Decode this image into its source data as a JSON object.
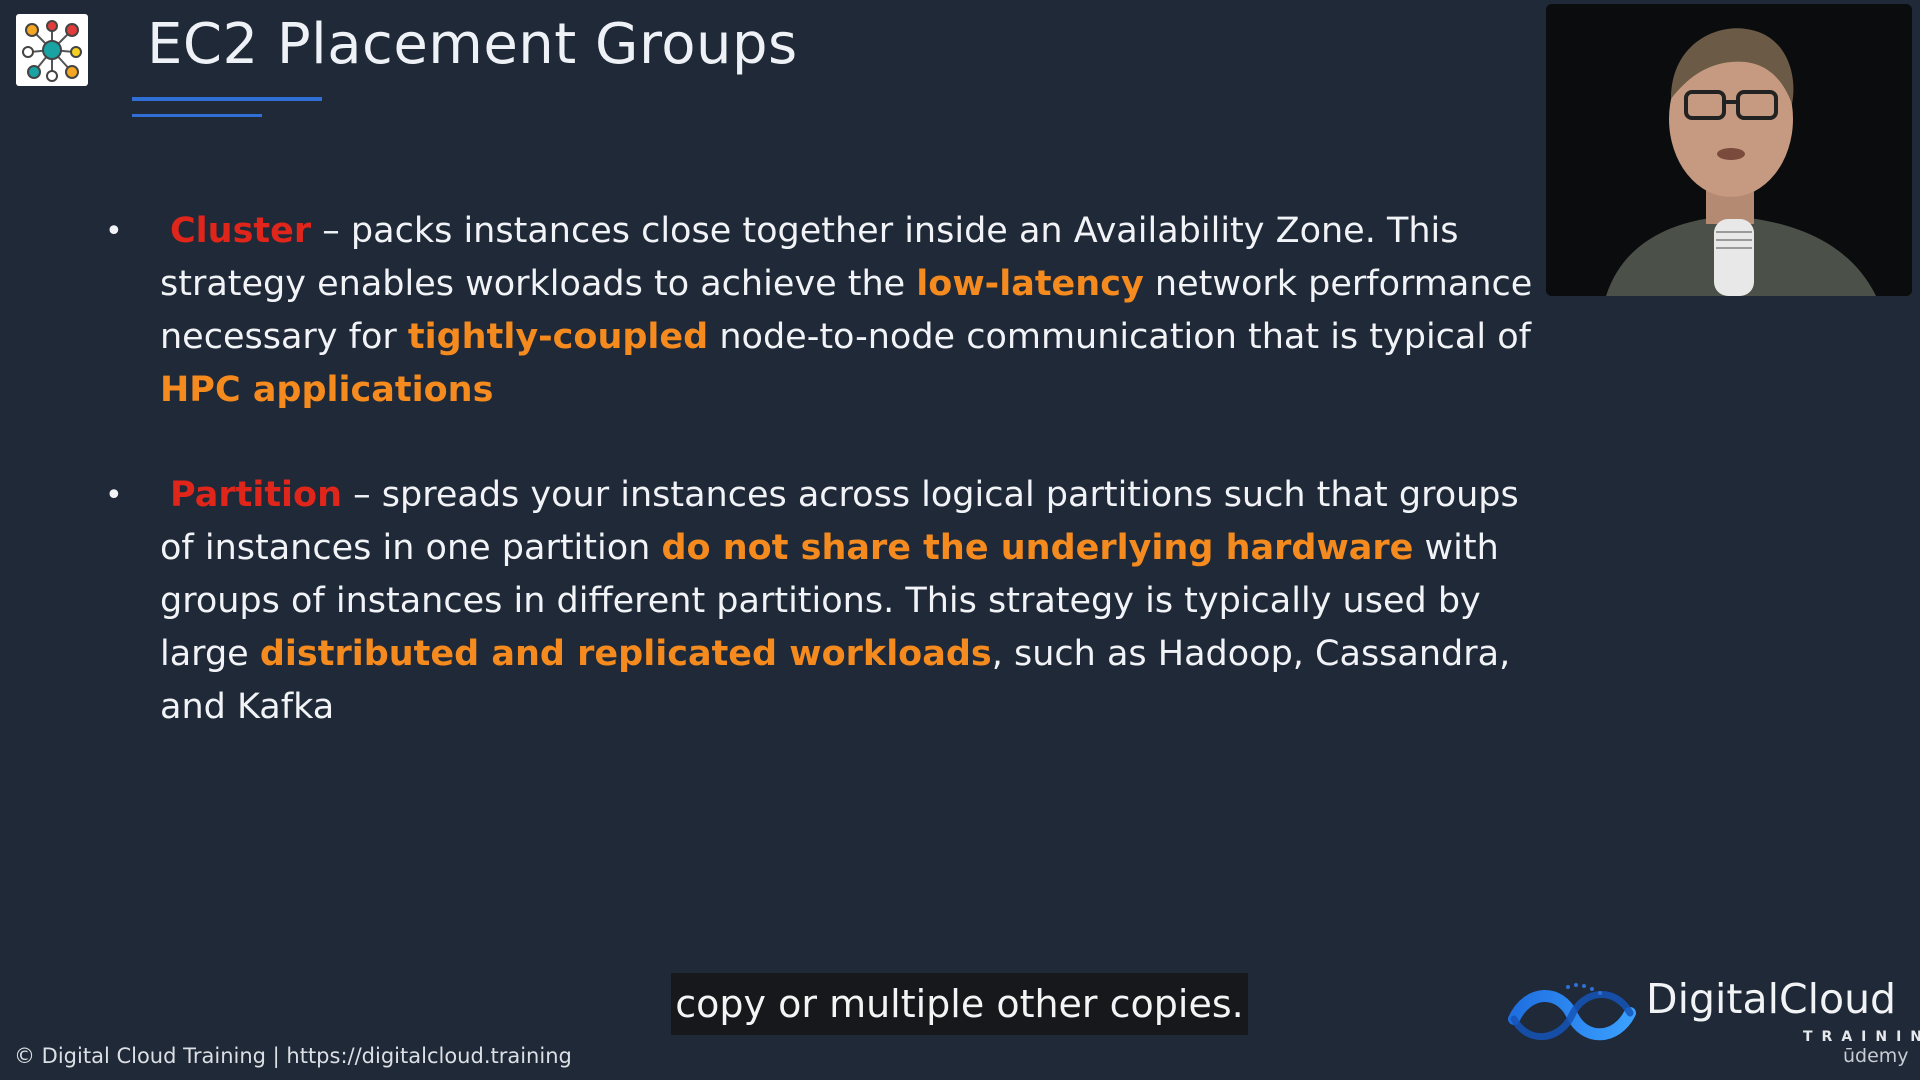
{
  "slide": {
    "title": "EC2 Placement Groups",
    "bullets": [
      {
        "term": "Cluster",
        "parts": [
          {
            "text": " – packs instances close together inside an Availability Zone. This strategy enables workloads to achieve the ",
            "highlight": false
          },
          {
            "text": "low-latency",
            "highlight": true
          },
          {
            "text": " network performance necessary for ",
            "highlight": false
          },
          {
            "text": "tightly-coupled",
            "highlight": true
          },
          {
            "text": " node-to-node communication that is typical of ",
            "highlight": false
          },
          {
            "text": "HPC applications",
            "highlight": true
          }
        ]
      },
      {
        "term": "Partition",
        "parts": [
          {
            "text": " – spreads your instances across logical partitions such that groups of instances in one partition ",
            "highlight": false
          },
          {
            "text": "do not share the underlying hardware",
            "highlight": true
          },
          {
            "text": " with groups of instances in different partitions. This strategy is typically used by large ",
            "highlight": false
          },
          {
            "text": "distributed and replicated workloads",
            "highlight": true
          },
          {
            "text": ", such as Hadoop, Cassandra, and Kafka",
            "highlight": false
          }
        ]
      }
    ]
  },
  "caption": "copy or multiple other copies.",
  "footer": "© Digital Cloud Training  | https://digitalcloud.training",
  "brand": {
    "name": "DigitalCloud",
    "sub": "TRAINING",
    "platform": "ūdemy"
  },
  "colors": {
    "background": "#1f2937",
    "term": "#e0261b",
    "highlight": "#f58a1f",
    "accent": "#2f6fd6"
  },
  "icons": {
    "logo": "network-nodes-icon",
    "brand": "cloud-wave-icon"
  }
}
